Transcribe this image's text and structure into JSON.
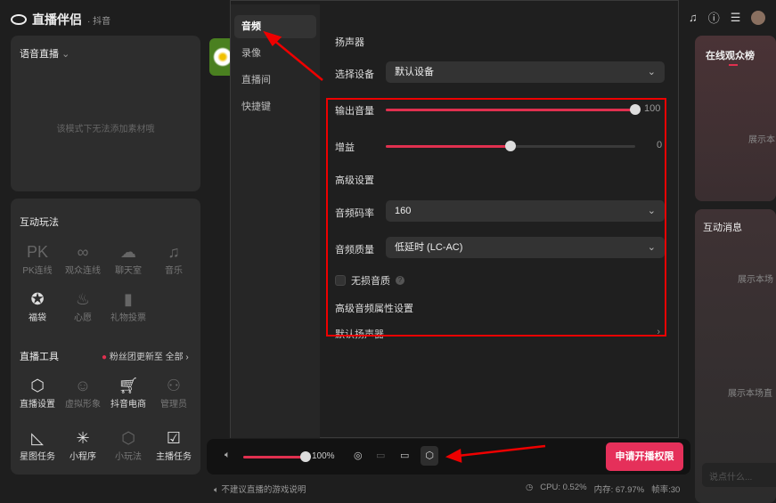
{
  "app": {
    "title": "直播伴侣",
    "platform": "· 抖音"
  },
  "left": {
    "voice": {
      "title": "语音直播",
      "empty": "该模式下无法添加素材哦"
    },
    "interact": {
      "title": "互动玩法",
      "items": [
        {
          "label": "PK连线",
          "icon": "pk-icon",
          "on": false
        },
        {
          "label": "观众连线",
          "icon": "link-icon",
          "on": false
        },
        {
          "label": "聊天室",
          "icon": "chat-room-icon",
          "on": false
        },
        {
          "label": "音乐",
          "icon": "music-icon",
          "on": false
        },
        {
          "label": "福袋",
          "icon": "lucky-bag-icon",
          "on": true
        },
        {
          "label": "心愿",
          "icon": "wish-lamp-icon",
          "on": false
        },
        {
          "label": "礼物投票",
          "icon": "vote-chart-icon",
          "on": false
        }
      ]
    },
    "tools": {
      "title": "直播工具",
      "notice": "粉丝团更新至",
      "all": "全部",
      "items": [
        {
          "label": "直播设置",
          "icon": "hex-settings-icon",
          "on": true
        },
        {
          "label": "虚拟形象",
          "icon": "avatar-icon",
          "on": false
        },
        {
          "label": "抖音电商",
          "icon": "cart-icon",
          "on": true
        },
        {
          "label": "管理员",
          "icon": "admin-icon",
          "on": false
        },
        {
          "label": "星图任务",
          "icon": "star-map-icon",
          "on": true
        },
        {
          "label": "小程序",
          "icon": "mini-program-icon",
          "on": true
        },
        {
          "label": "小玩法",
          "icon": "mini-game-icon",
          "on": false
        },
        {
          "label": "主播任务",
          "icon": "calendar-task-icon",
          "on": true
        }
      ]
    }
  },
  "modal": {
    "tabs": [
      "音频",
      "录像",
      "直播间",
      "快捷键"
    ],
    "active_tab": "音频",
    "speaker_title": "扬声器",
    "device_label": "选择设备",
    "device_value": "默认设备",
    "output_label": "输出音量",
    "output_value": "100",
    "output_pct": 100,
    "gain_label": "增益",
    "gain_value": "0",
    "gain_pct": 50,
    "advanced_title": "高级设置",
    "bitrate_label": "音频码率",
    "bitrate_value": "160",
    "quality_label": "音频质量",
    "quality_value": "低延时 (LC-AC)",
    "lossless_label": "无损音质",
    "lossless_checked": false,
    "adv_audio_title": "高级音频属性设置",
    "default_speaker": "默认扬声器"
  },
  "bottom": {
    "volume": "100%",
    "volume_pct": 100,
    "apply_button": "申请开播权限",
    "tip": "不建议直播的游戏说明",
    "cpu": "CPU: 0.52%",
    "mem": "内存: 67.97%",
    "fps": "帧率:30"
  },
  "right": {
    "audience_title": "在线观众榜",
    "audience_empty": "展示本",
    "messages_title": "互动消息",
    "msg_empty1": "展示本场",
    "msg_empty2": "展示本场直",
    "chat_placeholder": "说点什么..."
  },
  "colors": {
    "accent": "#e0304f",
    "annotation": "#ee0000"
  }
}
